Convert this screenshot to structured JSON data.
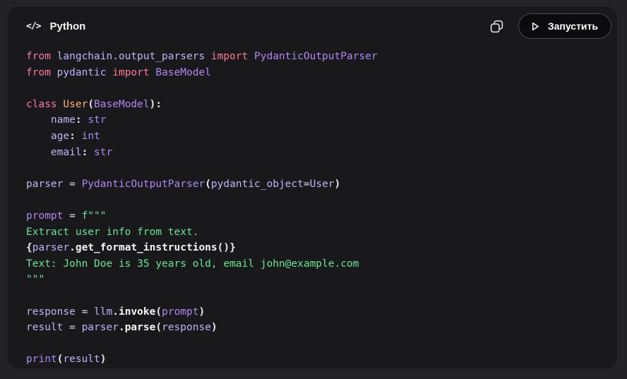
{
  "header": {
    "title": "Python",
    "code_glyph": "</>",
    "run_button": {
      "label": "Запустить"
    }
  },
  "colors": {
    "page_bg": "#232327",
    "card_bg": "#19191c",
    "icon_gray": "#e4e4e7",
    "token": {
      "kw": "#fb7a9c",
      "var": "#c3b2f5",
      "cls": "#a88cf2",
      "def": "#ffb176",
      "str": "#6fe394",
      "pun": "#ececf0",
      "fn": "#f5f5f7",
      "op": "#d9d9de",
      "pln": "#e8e8ea"
    }
  },
  "code": {
    "lines": [
      [
        [
          "kw",
          "from "
        ],
        [
          "var",
          "langchain.output_parsers "
        ],
        [
          "kw",
          "import "
        ],
        [
          "cls",
          "PydanticOutputParser"
        ]
      ],
      [
        [
          "kw",
          "from "
        ],
        [
          "var",
          "pydantic "
        ],
        [
          "kw",
          "import "
        ],
        [
          "cls",
          "BaseModel"
        ]
      ],
      [],
      [
        [
          "kw",
          "class "
        ],
        [
          "def",
          "User"
        ],
        [
          "pun",
          "("
        ],
        [
          "cls",
          "BaseModel"
        ],
        [
          "pun",
          "):"
        ]
      ],
      [
        [
          "pln",
          "    "
        ],
        [
          "var",
          "name"
        ],
        [
          "pun",
          ": "
        ],
        [
          "cls",
          "str"
        ]
      ],
      [
        [
          "pln",
          "    "
        ],
        [
          "var",
          "age"
        ],
        [
          "pun",
          ": "
        ],
        [
          "cls",
          "int"
        ]
      ],
      [
        [
          "pln",
          "    "
        ],
        [
          "var",
          "email"
        ],
        [
          "pun",
          ": "
        ],
        [
          "cls",
          "str"
        ]
      ],
      [],
      [
        [
          "var",
          "parser "
        ],
        [
          "op",
          "= "
        ],
        [
          "cls",
          "PydanticOutputParser"
        ],
        [
          "pun",
          "("
        ],
        [
          "var",
          "pydantic_object"
        ],
        [
          "op",
          "="
        ],
        [
          "var",
          "User"
        ],
        [
          "pun",
          ")"
        ]
      ],
      [],
      [
        [
          "cls",
          "prompt "
        ],
        [
          "op",
          "= "
        ],
        [
          "str",
          "f\"\"\""
        ]
      ],
      [
        [
          "str",
          "Extract user info from text."
        ]
      ],
      [
        [
          "pun",
          "{"
        ],
        [
          "var",
          "parser"
        ],
        [
          "pun",
          "."
        ],
        [
          "fn",
          "get_format_instructions"
        ],
        [
          "pun",
          "()}"
        ]
      ],
      [
        [
          "str",
          "Text: John Doe is 35 years old, email john@example.com"
        ]
      ],
      [
        [
          "str",
          "\"\"\""
        ]
      ],
      [],
      [
        [
          "var",
          "response "
        ],
        [
          "op",
          "= "
        ],
        [
          "var",
          "llm"
        ],
        [
          "pun",
          "."
        ],
        [
          "fn",
          "invoke"
        ],
        [
          "pun",
          "("
        ],
        [
          "cls",
          "prompt"
        ],
        [
          "pun",
          ")"
        ]
      ],
      [
        [
          "var",
          "result "
        ],
        [
          "op",
          "= "
        ],
        [
          "var",
          "parser"
        ],
        [
          "pun",
          "."
        ],
        [
          "fn",
          "parse"
        ],
        [
          "pun",
          "("
        ],
        [
          "var",
          "response"
        ],
        [
          "pun",
          ")"
        ]
      ],
      [],
      [
        [
          "cls",
          "print"
        ],
        [
          "pun",
          "("
        ],
        [
          "var",
          "result"
        ],
        [
          "pun",
          ")"
        ]
      ]
    ]
  }
}
